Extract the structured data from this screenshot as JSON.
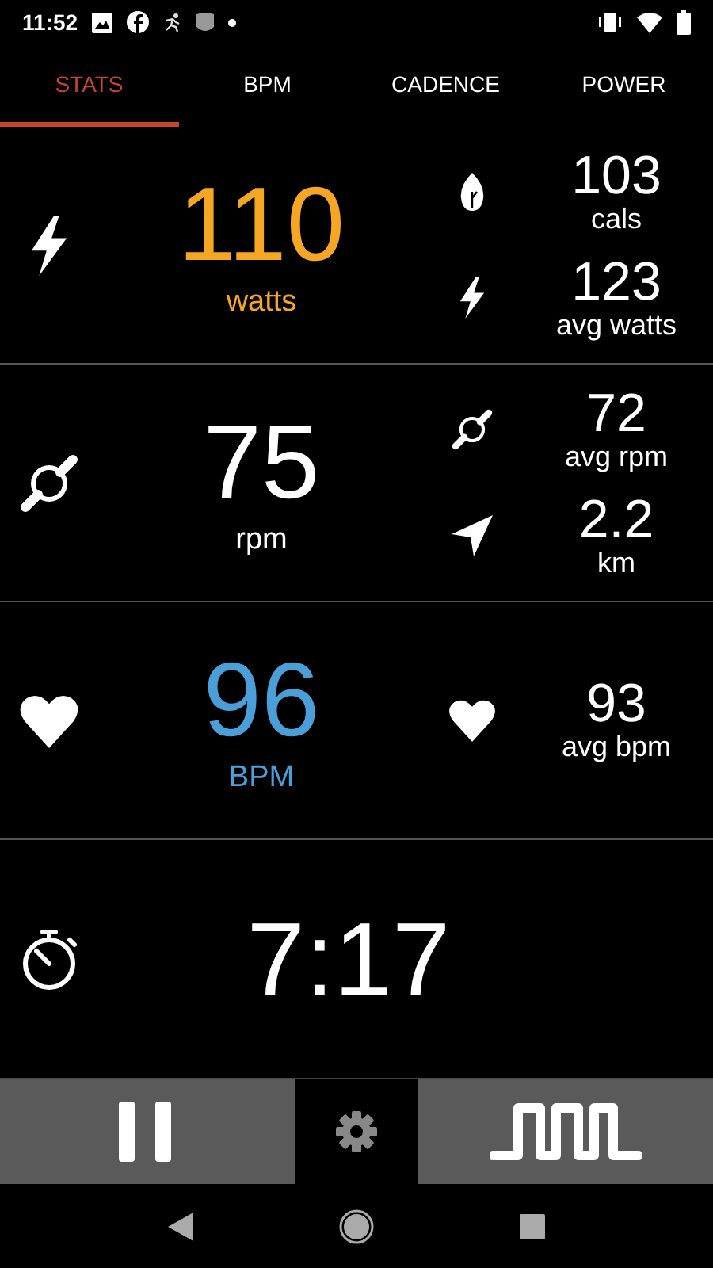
{
  "status_bar": {
    "time": "11:52"
  },
  "tabs": [
    {
      "label": "STATS",
      "selected": true
    },
    {
      "label": "BPM",
      "selected": false
    },
    {
      "label": "CADENCE",
      "selected": false
    },
    {
      "label": "POWER",
      "selected": false
    }
  ],
  "sections": [
    {
      "kind": "power",
      "value": "110",
      "unit": "watts",
      "color": "#f5a623",
      "side": [
        {
          "kind": "calories",
          "value": "103",
          "label": "cals"
        },
        {
          "kind": "power",
          "value": "123",
          "label": "avg watts"
        }
      ]
    },
    {
      "kind": "cadence",
      "value": "75",
      "unit": "rpm",
      "color": "#ffffff",
      "side": [
        {
          "kind": "cadence",
          "value": "72",
          "label": "avg rpm"
        },
        {
          "kind": "distance",
          "value": "2.2",
          "label": "km"
        }
      ]
    },
    {
      "kind": "heart",
      "value": "96",
      "unit": "BPM",
      "color": "#4a9fd8",
      "side": [
        {
          "kind": "heart",
          "value": "93",
          "label": "avg bpm"
        }
      ]
    },
    {
      "kind": "timer",
      "value": "7:17",
      "color": "#ffffff"
    }
  ]
}
